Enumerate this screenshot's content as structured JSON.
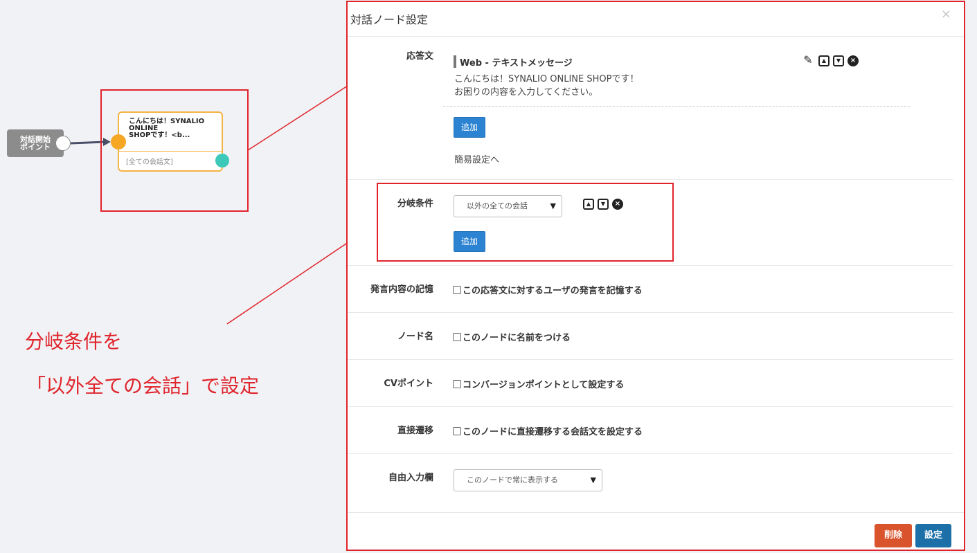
{
  "canvas": {
    "start_node_label": "対話開始\nポイント",
    "conversation_node_text": "こんにちは！SYNALIO\nONLINE\nSHOPです！<b...",
    "conversation_node_branch": "[全ての会話文]"
  },
  "annotation": {
    "line1": "分岐条件を",
    "line2": "「以外全ての会話」で設定",
    "color": "#e0242c"
  },
  "modal": {
    "title": "対話ノード設定",
    "close_glyph": "×",
    "response": {
      "label": "応答文",
      "message_type": "Web - テキストメッセージ",
      "message_body": "こんにちは！SYNALIO ONLINE SHOPです！\nお困りの内容を入力してください。",
      "add_label": "追加",
      "simple_settings_link": "簡易設定へ"
    },
    "branch": {
      "label": "分岐条件",
      "selected": "以外の全ての会話",
      "add_label": "追加"
    },
    "remember": {
      "label": "発言内容の記憶",
      "checkbox_label": "この応答文に対するユーザの発言を記憶する"
    },
    "node_name": {
      "label": "ノード名",
      "checkbox_label": "このノードに名前をつける"
    },
    "cv_point": {
      "label": "CVポイント",
      "checkbox_label": "コンバージョンポイントとして設定する"
    },
    "direct": {
      "label": "直接遷移",
      "checkbox_label": "このノードに直接遷移する会話文を設定する"
    },
    "free_input": {
      "label": "自由入力欄",
      "selected": "このノードで常に表示する"
    },
    "delete_label": "削除",
    "save_label": "設定"
  },
  "colors": {
    "primary": "#2b83d1",
    "danger": "#d9532c",
    "save": "#1d6fa8",
    "node_border": "#f5b342",
    "port_out": "#3cc9b9"
  },
  "icons": [
    "edit-icon",
    "move-up-icon",
    "move-down-icon",
    "remove-icon"
  ]
}
